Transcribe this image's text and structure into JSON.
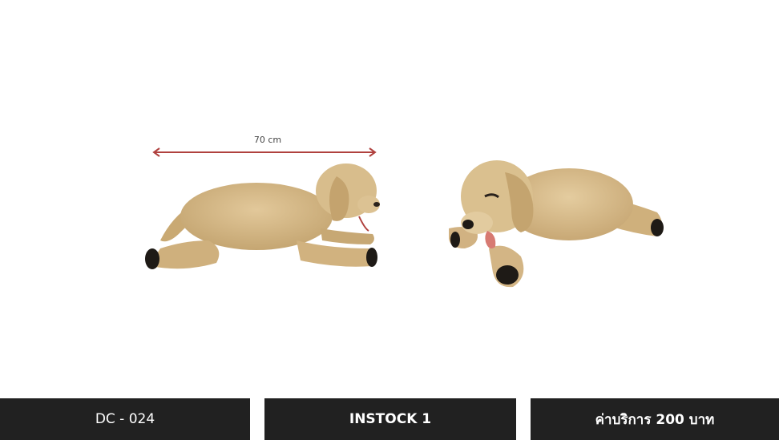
{
  "product": {
    "image_alt": "Plush golden retriever dog toy, side and front views",
    "dimension_label": "70 cm"
  },
  "info": {
    "code": "DC - 024",
    "stock": "INSTOCK 1",
    "price": "ค่าบริการ 200 บาท"
  },
  "colors": {
    "bar_background": "#212121",
    "bar_text": "#ffffff",
    "dimension_arrow": "#b0413e",
    "plush_fur": "#d2b483"
  }
}
